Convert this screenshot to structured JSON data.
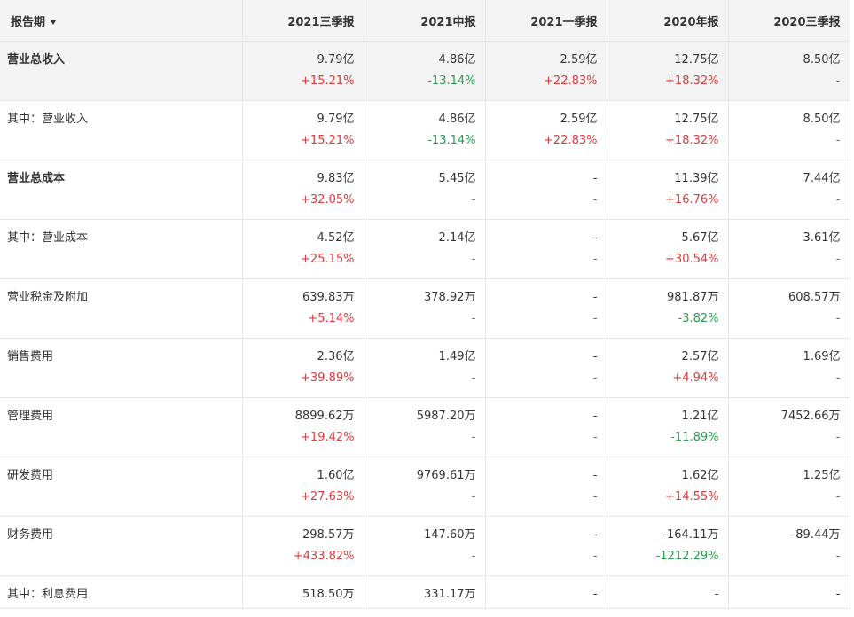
{
  "header": {
    "period_label": "报告期",
    "columns": [
      "2021三季报",
      "2021中报",
      "2021一季报",
      "2020年报",
      "2020三季报"
    ]
  },
  "rows": [
    {
      "label": "营业总收入",
      "bold": true,
      "highlight": true,
      "cells": [
        {
          "value": "9.79亿",
          "change": "+15.21%"
        },
        {
          "value": "4.86亿",
          "change": "-13.14%"
        },
        {
          "value": "2.59亿",
          "change": "+22.83%"
        },
        {
          "value": "12.75亿",
          "change": "+18.32%"
        },
        {
          "value": "8.50亿",
          "change": "-"
        }
      ]
    },
    {
      "label": "其中：营业收入",
      "bold": false,
      "highlight": false,
      "cells": [
        {
          "value": "9.79亿",
          "change": "+15.21%"
        },
        {
          "value": "4.86亿",
          "change": "-13.14%"
        },
        {
          "value": "2.59亿",
          "change": "+22.83%"
        },
        {
          "value": "12.75亿",
          "change": "+18.32%"
        },
        {
          "value": "8.50亿",
          "change": "-"
        }
      ]
    },
    {
      "label": "营业总成本",
      "bold": true,
      "highlight": false,
      "cells": [
        {
          "value": "9.83亿",
          "change": "+32.05%"
        },
        {
          "value": "5.45亿",
          "change": "-"
        },
        {
          "value": "-",
          "change": "-"
        },
        {
          "value": "11.39亿",
          "change": "+16.76%"
        },
        {
          "value": "7.44亿",
          "change": "-"
        }
      ]
    },
    {
      "label": "其中：营业成本",
      "bold": false,
      "highlight": false,
      "cells": [
        {
          "value": "4.52亿",
          "change": "+25.15%"
        },
        {
          "value": "2.14亿",
          "change": "-"
        },
        {
          "value": "-",
          "change": "-"
        },
        {
          "value": "5.67亿",
          "change": "+30.54%"
        },
        {
          "value": "3.61亿",
          "change": "-"
        }
      ]
    },
    {
      "label": "营业税金及附加",
      "bold": false,
      "highlight": false,
      "cells": [
        {
          "value": "639.83万",
          "change": "+5.14%"
        },
        {
          "value": "378.92万",
          "change": "-"
        },
        {
          "value": "-",
          "change": "-"
        },
        {
          "value": "981.87万",
          "change": "-3.82%"
        },
        {
          "value": "608.57万",
          "change": "-"
        }
      ]
    },
    {
      "label": "销售费用",
      "bold": false,
      "highlight": false,
      "cells": [
        {
          "value": "2.36亿",
          "change": "+39.89%"
        },
        {
          "value": "1.49亿",
          "change": "-"
        },
        {
          "value": "-",
          "change": "-"
        },
        {
          "value": "2.57亿",
          "change": "+4.94%"
        },
        {
          "value": "1.69亿",
          "change": "-"
        }
      ]
    },
    {
      "label": "管理费用",
      "bold": false,
      "highlight": false,
      "cells": [
        {
          "value": "8899.62万",
          "change": "+19.42%"
        },
        {
          "value": "5987.20万",
          "change": "-"
        },
        {
          "value": "-",
          "change": "-"
        },
        {
          "value": "1.21亿",
          "change": "-11.89%"
        },
        {
          "value": "7452.66万",
          "change": "-"
        }
      ]
    },
    {
      "label": "研发费用",
      "bold": false,
      "highlight": false,
      "cells": [
        {
          "value": "1.60亿",
          "change": "+27.63%"
        },
        {
          "value": "9769.61万",
          "change": "-"
        },
        {
          "value": "-",
          "change": "-"
        },
        {
          "value": "1.62亿",
          "change": "+14.55%"
        },
        {
          "value": "1.25亿",
          "change": "-"
        }
      ]
    },
    {
      "label": "财务费用",
      "bold": false,
      "highlight": false,
      "cells": [
        {
          "value": "298.57万",
          "change": "+433.82%"
        },
        {
          "value": "147.60万",
          "change": "-"
        },
        {
          "value": "-",
          "change": "-"
        },
        {
          "value": "-164.11万",
          "change": "-1212.29%"
        },
        {
          "value": "-89.44万",
          "change": "-"
        }
      ]
    },
    {
      "label": "其中：利息费用",
      "bold": false,
      "highlight": false,
      "cells": [
        {
          "value": "518.50万",
          "change": ""
        },
        {
          "value": "331.17万",
          "change": ""
        },
        {
          "value": "-",
          "change": ""
        },
        {
          "value": "-",
          "change": ""
        },
        {
          "value": "-",
          "change": ""
        }
      ]
    }
  ]
}
